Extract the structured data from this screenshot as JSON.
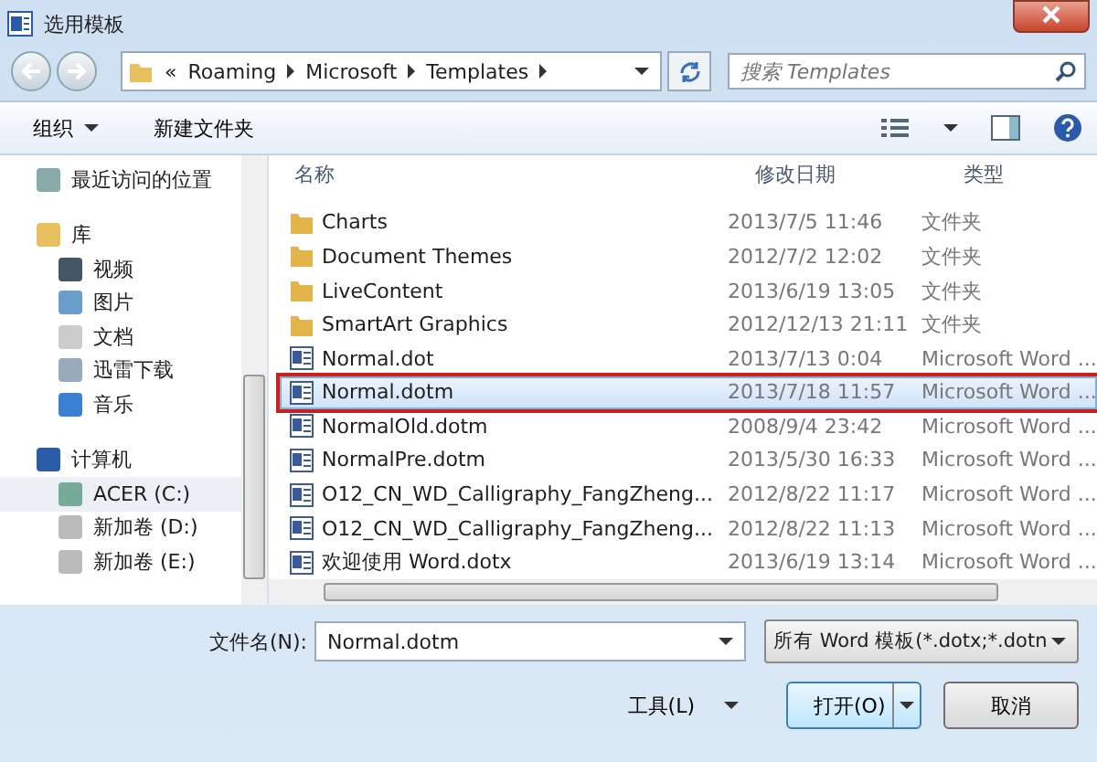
{
  "window": {
    "title": "选用模板"
  },
  "address": {
    "crumbs": [
      "«",
      "Roaming",
      "Microsoft",
      "Templates"
    ]
  },
  "search": {
    "placeholder": "搜索 Templates"
  },
  "toolbar": {
    "organize": "组织",
    "new_folder": "新建文件夹"
  },
  "sidebar": {
    "items": [
      {
        "label": "最近访问的位置",
        "kind": "recent",
        "selected": false
      },
      {
        "label": "库",
        "kind": "library",
        "selected": false,
        "children": [
          {
            "label": "视频",
            "kind": "video",
            "selected": false
          },
          {
            "label": "图片",
            "kind": "picture",
            "selected": false
          },
          {
            "label": "文档",
            "kind": "document",
            "selected": false
          },
          {
            "label": "迅雷下载",
            "kind": "download",
            "selected": false
          },
          {
            "label": "音乐",
            "kind": "music",
            "selected": false
          }
        ]
      },
      {
        "label": "计算机",
        "kind": "computer",
        "selected": false,
        "children": [
          {
            "label": "ACER (C:)",
            "kind": "system-drive",
            "selected": true
          },
          {
            "label": "新加卷 (D:)",
            "kind": "drive",
            "selected": false
          },
          {
            "label": "新加卷 (E:)",
            "kind": "drive",
            "selected": false
          }
        ]
      }
    ]
  },
  "table": {
    "columns": [
      "名称",
      "修改日期",
      "类型"
    ],
    "rows": [
      {
        "name": "Charts",
        "date": "2013/7/5 11:46",
        "type": "文件夹",
        "kind": "folder",
        "selected": false,
        "highlighted": false
      },
      {
        "name": "Document Themes",
        "date": "2012/7/2 12:02",
        "type": "文件夹",
        "kind": "folder",
        "selected": false,
        "highlighted": false
      },
      {
        "name": "LiveContent",
        "date": "2013/6/19 13:05",
        "type": "文件夹",
        "kind": "folder",
        "selected": false,
        "highlighted": false
      },
      {
        "name": "SmartArt Graphics",
        "date": "2012/12/13 21:11",
        "type": "文件夹",
        "kind": "folder",
        "selected": false,
        "highlighted": false
      },
      {
        "name": "Normal.dot",
        "date": "2013/7/13 0:04",
        "type": "Microsoft Word ...",
        "kind": "file",
        "selected": false,
        "highlighted": false
      },
      {
        "name": "Normal.dotm",
        "date": "2013/7/18 11:57",
        "type": "Microsoft Word ...",
        "kind": "file",
        "selected": true,
        "highlighted": true
      },
      {
        "name": "NormalOld.dotm",
        "date": "2008/9/4 23:42",
        "type": "Microsoft Word ...",
        "kind": "file",
        "selected": false,
        "highlighted": false
      },
      {
        "name": "NormalPre.dotm",
        "date": "2013/5/30 16:33",
        "type": "Microsoft Word ...",
        "kind": "file",
        "selected": false,
        "highlighted": false
      },
      {
        "name": "O12_CN_WD_Calligraphy_FangZheng...",
        "date": "2012/8/22 11:17",
        "type": "Microsoft Word ...",
        "kind": "file",
        "selected": false,
        "highlighted": false
      },
      {
        "name": "O12_CN_WD_Calligraphy_FangZheng...",
        "date": "2012/8/22 11:13",
        "type": "Microsoft Word ...",
        "kind": "file",
        "selected": false,
        "highlighted": false
      },
      {
        "name": "欢迎使用 Word.dotx",
        "date": "2013/6/19 13:14",
        "type": "Microsoft Word ...",
        "kind": "file",
        "selected": false,
        "highlighted": false
      }
    ]
  },
  "footer": {
    "filename_label": "文件名(N):",
    "filename_value": "Normal.dotm",
    "filter": "所有 Word 模板(*.dotx;*.dotn",
    "tools": "工具(L)",
    "open": "打开(O)",
    "cancel": "取消"
  }
}
